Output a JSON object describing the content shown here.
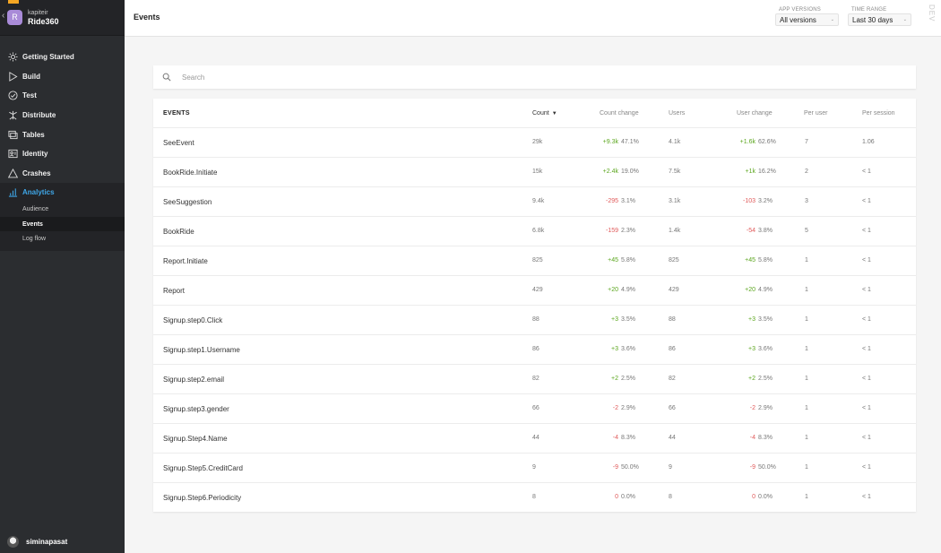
{
  "app": {
    "org": "kapiteir",
    "name": "Ride360",
    "avatar_letter": "R"
  },
  "nav": [
    {
      "label": "Getting Started",
      "icon": "sun-icon",
      "name": "nav-getting-started"
    },
    {
      "label": "Build",
      "icon": "play-icon",
      "name": "nav-build"
    },
    {
      "label": "Test",
      "icon": "check-circle-icon",
      "name": "nav-test"
    },
    {
      "label": "Distribute",
      "icon": "distribute-icon",
      "name": "nav-distribute"
    },
    {
      "label": "Tables",
      "icon": "tables-icon",
      "name": "nav-tables"
    },
    {
      "label": "Identity",
      "icon": "identity-icon",
      "name": "nav-identity"
    },
    {
      "label": "Crashes",
      "icon": "warning-icon",
      "name": "nav-crashes"
    },
    {
      "label": "Analytics",
      "icon": "bar-chart-icon",
      "name": "nav-analytics"
    }
  ],
  "subnav": [
    {
      "label": "Audience"
    },
    {
      "label": "Events"
    },
    {
      "label": "Log flow"
    }
  ],
  "user": {
    "name": "siminapasat"
  },
  "header": {
    "title": "Events",
    "app_versions_label": "APP VERSIONS",
    "app_versions_value": "All versions",
    "time_range_label": "TIME RANGE",
    "time_range_value": "Last 30 days",
    "env_tag": "DEV"
  },
  "search": {
    "placeholder": "Search"
  },
  "table": {
    "columns": {
      "events": "EVENTS",
      "count": "Count",
      "count_change": "Count change",
      "users": "Users",
      "user_change": "User change",
      "per_user": "Per user",
      "per_session": "Per session"
    },
    "rows": [
      {
        "name": "SeeEvent",
        "count": "29k",
        "cc_d": "+9.3k",
        "cc_p": "47.1%",
        "cc_s": "pos",
        "users": "4.1k",
        "uc_d": "+1.6k",
        "uc_p": "62.6%",
        "uc_s": "pos",
        "per_user": "7",
        "per_session": "1.06"
      },
      {
        "name": "BookRide.Initiate",
        "count": "15k",
        "cc_d": "+2.4k",
        "cc_p": "19.0%",
        "cc_s": "pos",
        "users": "7.5k",
        "uc_d": "+1k",
        "uc_p": "16.2%",
        "uc_s": "pos",
        "per_user": "2",
        "per_session": "< 1"
      },
      {
        "name": "SeeSuggestion",
        "count": "9.4k",
        "cc_d": "-295",
        "cc_p": "3.1%",
        "cc_s": "neg",
        "users": "3.1k",
        "uc_d": "-103",
        "uc_p": "3.2%",
        "uc_s": "neg",
        "per_user": "3",
        "per_session": "< 1"
      },
      {
        "name": "BookRide",
        "count": "6.8k",
        "cc_d": "-159",
        "cc_p": "2.3%",
        "cc_s": "neg",
        "users": "1.4k",
        "uc_d": "-54",
        "uc_p": "3.8%",
        "uc_s": "neg",
        "per_user": "5",
        "per_session": "< 1"
      },
      {
        "name": "Report.Initiate",
        "count": "825",
        "cc_d": "+45",
        "cc_p": "5.8%",
        "cc_s": "pos",
        "users": "825",
        "uc_d": "+45",
        "uc_p": "5.8%",
        "uc_s": "pos",
        "per_user": "1",
        "per_session": "< 1"
      },
      {
        "name": "Report",
        "count": "429",
        "cc_d": "+20",
        "cc_p": "4.9%",
        "cc_s": "pos",
        "users": "429",
        "uc_d": "+20",
        "uc_p": "4.9%",
        "uc_s": "pos",
        "per_user": "1",
        "per_session": "< 1"
      },
      {
        "name": "Signup.step0.Click",
        "count": "88",
        "cc_d": "+3",
        "cc_p": "3.5%",
        "cc_s": "pos",
        "users": "88",
        "uc_d": "+3",
        "uc_p": "3.5%",
        "uc_s": "pos",
        "per_user": "1",
        "per_session": "< 1"
      },
      {
        "name": "Signup.step1.Username",
        "count": "86",
        "cc_d": "+3",
        "cc_p": "3.6%",
        "cc_s": "pos",
        "users": "86",
        "uc_d": "+3",
        "uc_p": "3.6%",
        "uc_s": "pos",
        "per_user": "1",
        "per_session": "< 1"
      },
      {
        "name": "Signup.step2.email",
        "count": "82",
        "cc_d": "+2",
        "cc_p": "2.5%",
        "cc_s": "pos",
        "users": "82",
        "uc_d": "+2",
        "uc_p": "2.5%",
        "uc_s": "pos",
        "per_user": "1",
        "per_session": "< 1"
      },
      {
        "name": "Signup.step3.gender",
        "count": "66",
        "cc_d": "-2",
        "cc_p": "2.9%",
        "cc_s": "neg",
        "users": "66",
        "uc_d": "-2",
        "uc_p": "2.9%",
        "uc_s": "neg",
        "per_user": "1",
        "per_session": "< 1"
      },
      {
        "name": "Signup.Step4.Name",
        "count": "44",
        "cc_d": "-4",
        "cc_p": "8.3%",
        "cc_s": "neg",
        "users": "44",
        "uc_d": "-4",
        "uc_p": "8.3%",
        "uc_s": "neg",
        "per_user": "1",
        "per_session": "< 1"
      },
      {
        "name": "Signup.Step5.CreditCard",
        "count": "9",
        "cc_d": "-9",
        "cc_p": "50.0%",
        "cc_s": "neg",
        "users": "9",
        "uc_d": "-9",
        "uc_p": "50.0%",
        "uc_s": "neg",
        "per_user": "1",
        "per_session": "< 1"
      },
      {
        "name": "Signup.Step6.Periodicity",
        "count": "8",
        "cc_d": "0",
        "cc_p": "0.0%",
        "cc_s": "neu",
        "users": "8",
        "uc_d": "0",
        "uc_p": "0.0%",
        "uc_s": "neu",
        "per_user": "1",
        "per_session": "< 1"
      }
    ]
  },
  "colors": {
    "sidebar_bg": "#2b2d30",
    "accent": "#3fa7e8",
    "positive": "#5ba61e",
    "negative": "#e05a5a"
  }
}
